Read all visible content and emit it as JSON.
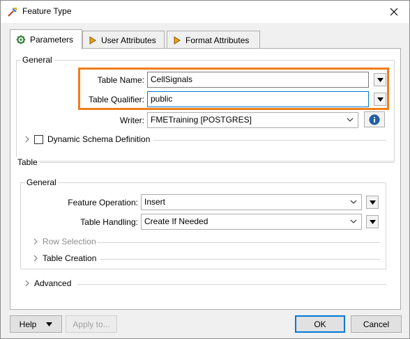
{
  "window": {
    "title": "Feature Type"
  },
  "tabs": [
    {
      "label": "Parameters",
      "icon": "gear-icon"
    },
    {
      "label": "User Attributes",
      "icon": "arrow-right-icon"
    },
    {
      "label": "Format Attributes",
      "icon": "arrow-right-icon"
    }
  ],
  "general": {
    "label": "General",
    "table_name": {
      "label": "Table Name:",
      "value": "CellSignals"
    },
    "table_qualifier": {
      "label": "Table Qualifier:",
      "value": "public"
    },
    "writer": {
      "label": "Writer:",
      "value": "FMETraining [POSTGRES]"
    },
    "dynamic_schema": {
      "label": "Dynamic Schema Definition",
      "checked": false
    }
  },
  "table": {
    "label": "Table",
    "general_label": "General",
    "feature_operation": {
      "label": "Feature Operation:",
      "value": "Insert"
    },
    "table_handling": {
      "label": "Table Handling:",
      "value": "Create If Needed"
    },
    "row_selection": "Row Selection",
    "table_creation": "Table Creation"
  },
  "advanced": {
    "label": "Advanced"
  },
  "footer": {
    "help": "Help",
    "apply": "Apply to...",
    "ok": "OK",
    "cancel": "Cancel"
  },
  "colors": {
    "highlight": "#f07d1a",
    "focus": "#0078d7",
    "info_blue": "#1f5fa8"
  }
}
